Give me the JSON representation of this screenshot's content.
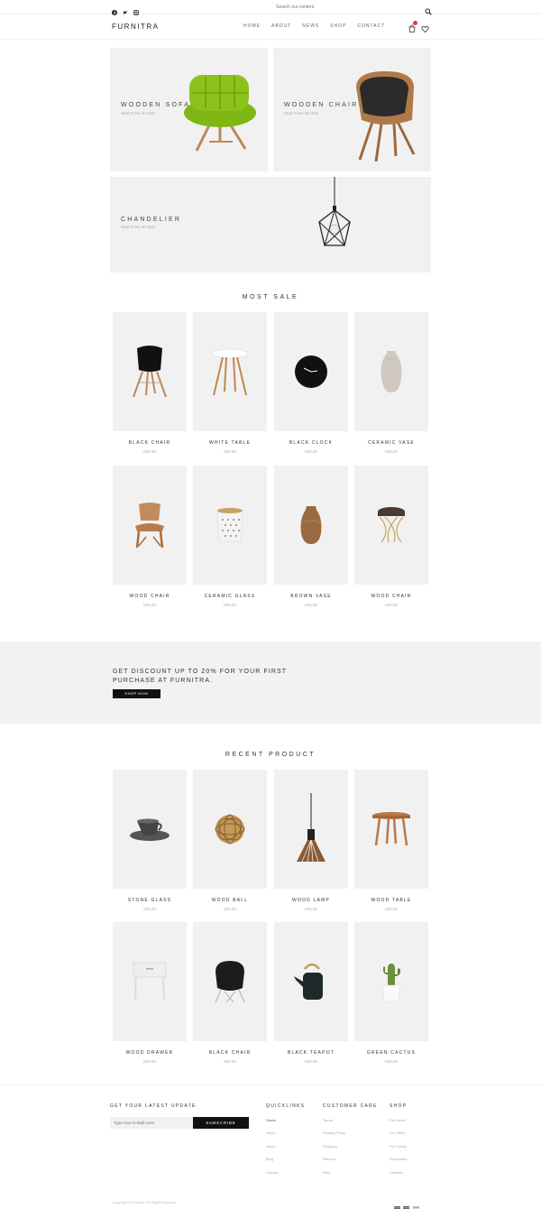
{
  "topbar": {
    "social": [
      "facebook-icon",
      "twitter-icon",
      "instagram-icon"
    ],
    "search_placeholder": "Search our content"
  },
  "header": {
    "logo": "FURNITRA",
    "nav": [
      "HOME",
      "ABOUT",
      "NEWS",
      "SHOP",
      "CONTACT"
    ]
  },
  "hero": [
    {
      "title": "WOODEN SOFA",
      "subtitle": "Start From 40 USD"
    },
    {
      "title": "WOODEN CHAIR",
      "subtitle": "Start From 40 USD"
    },
    {
      "title": "CHANDELIER",
      "subtitle": "Start From 40 USD"
    }
  ],
  "most_sale": {
    "title": "MOST SALE",
    "items": [
      {
        "name": "BLACK CHAIR",
        "price": "£50.00",
        "icon": "black-chair-icon"
      },
      {
        "name": "WHITE TABLE",
        "price": "£50.00",
        "icon": "white-table-icon"
      },
      {
        "name": "BLACK CLOCK",
        "price": "£50.00",
        "icon": "black-clock-icon"
      },
      {
        "name": "CERAMIC VASE",
        "price": "£50.00",
        "icon": "ceramic-vase-icon"
      },
      {
        "name": "WOOD CHAIR",
        "price": "£50.00",
        "icon": "wood-chair-icon"
      },
      {
        "name": "CERAMIC GLASS",
        "price": "£50.00",
        "icon": "ceramic-glass-icon"
      },
      {
        "name": "BROWN VASE",
        "price": "£50.00",
        "icon": "brown-vase-icon"
      },
      {
        "name": "WOOD CHAIR",
        "price": "£50.00",
        "icon": "stool-icon"
      }
    ]
  },
  "banner": {
    "text": "GET DISCOUNT UP TO 20% FOR YOUR FIRST PURCHASE AT FURNITRA.",
    "button": "SHOP NOW"
  },
  "recent": {
    "title": "RECENT PRODUCT",
    "items": [
      {
        "name": "STONE GLASS",
        "price": "£50.00",
        "icon": "cup-icon"
      },
      {
        "name": "WOOD BALL",
        "price": "£50.00",
        "icon": "wood-ball-icon"
      },
      {
        "name": "WOOD LAMP",
        "price": "£50.00",
        "icon": "lamp-icon"
      },
      {
        "name": "WOOD TABLE",
        "price": "£50.00",
        "icon": "wood-table-icon"
      },
      {
        "name": "WOOD DRAWER",
        "price": "£50.00",
        "icon": "drawer-icon"
      },
      {
        "name": "BLACK CHAIR",
        "price": "£50.00",
        "icon": "black-armchair-icon"
      },
      {
        "name": "BLACK TEAPOT",
        "price": "£50.00",
        "icon": "teapot-icon"
      },
      {
        "name": "GREEN CACTUS",
        "price": "£50.00",
        "icon": "cactus-icon"
      }
    ]
  },
  "footer": {
    "newsletter_title": "GET YOUR LATEST UPDATE",
    "email_placeholder": "Type Your E-Mail Here",
    "subscribe": "SUBSCRIBE",
    "columns": [
      {
        "title": "QUICKLINKS",
        "links": [
          "Home",
          "About",
          "News",
          "Blog",
          "Contact"
        ]
      },
      {
        "title": "CUSTOMER CARE",
        "links": [
          "Terms",
          "Privacy Policy",
          "Shipping",
          "Returns",
          "FAQ"
        ]
      },
      {
        "title": "SHOP",
        "links": [
          "For Home",
          "For Office",
          "For Family",
          "Decoration",
          "Ceramic"
        ]
      }
    ],
    "copyright": "Copyright © Furnitra. All Right Reserved",
    "payments": [
      "visa-icon",
      "mastercard-icon",
      "paypal-icon"
    ]
  },
  "colors": {
    "accent": "#111111",
    "badge": "#e33333",
    "panel": "#f1f1f1",
    "sofa": "#8bc31a"
  }
}
